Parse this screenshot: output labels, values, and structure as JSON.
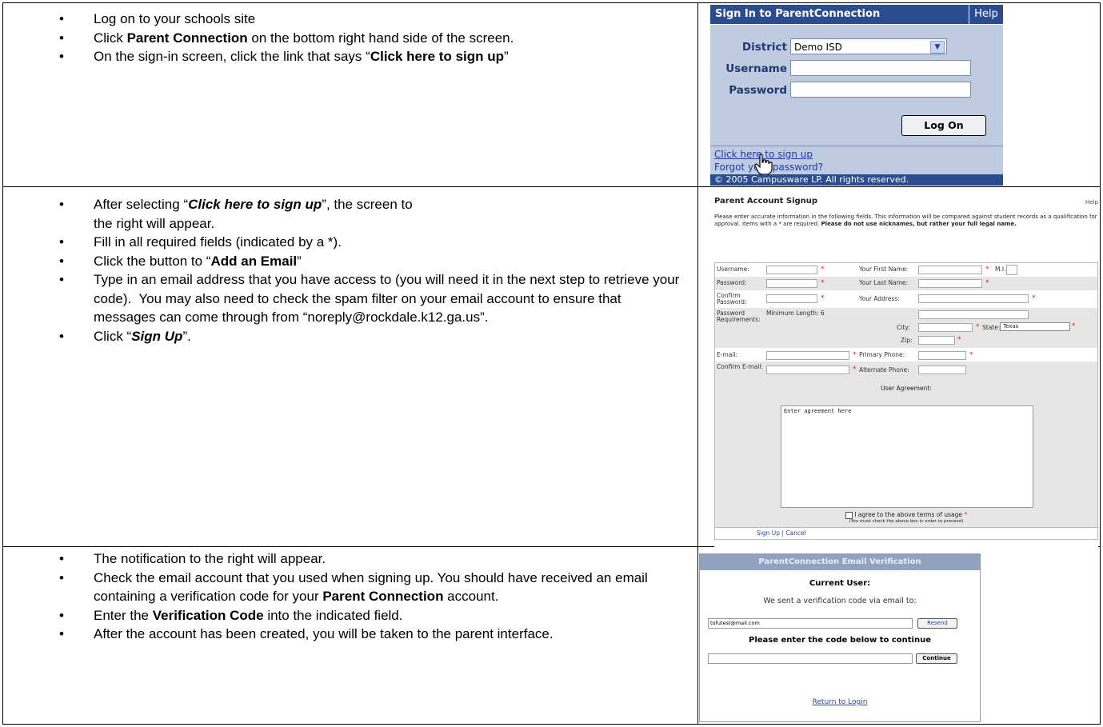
{
  "section1": {
    "steps": [
      [
        "Log on to your schools site"
      ],
      [
        "Click ",
        {
          "b": "Parent Connection"
        },
        " on the bottom right hand side of the screen."
      ],
      [
        "On the sign-in screen, click the link that says “",
        {
          "b": "Click here to sign up"
        },
        "”"
      ]
    ]
  },
  "section2": {
    "steps": [
      [
        "After selecting “",
        {
          "bi": "Click here to sign up"
        },
        "”, the screen to\nthe right will appear."
      ],
      [
        "Fill in all required fields (indicated by a *)."
      ],
      [
        "Click the button to “",
        {
          "b": "Add an Email"
        },
        "”"
      ],
      [
        "Type in an email address that you have access to (you will need it in the next step to retrieve your code).  You may also need to check the spam filter on your email account to ensure that messages can come through from “noreply@rockdale.k12.ga.us”."
      ],
      [
        "Click “",
        {
          "bi": "Sign Up"
        },
        "”."
      ]
    ]
  },
  "section3": {
    "steps": [
      [
        "The notification to the right will appear."
      ],
      [
        "Check the email account that you used when signing up. You should have received an email containing a verification code for your ",
        {
          "b": "Parent Connection"
        },
        " account."
      ],
      [
        "Enter the ",
        {
          "b": "Verification Code"
        },
        " into the indicated field."
      ],
      [
        "After the account has been created, you will be taken to the parent interface."
      ]
    ]
  },
  "signin": {
    "title": "Sign In to ParentConnection",
    "help": "Help",
    "district_label": "District",
    "district_value": "Demo ISD",
    "username_label": "Username",
    "password_label": "Password",
    "logon": "Log On",
    "signup_link": "Click here to sign up",
    "forgot_link": "Forgot your password?",
    "footer": "© 2005 Campusware LP. All rights reserved."
  },
  "signup": {
    "title": "Parent Account Signup",
    "help": "Help",
    "intro": "Please enter accurate information in the following fields.  This information will be compared against student records as a qualification for approval.  Items with a * are required.",
    "intro_bold": "Please do not use nicknames, but rather your full legal name.",
    "username": "Username:",
    "password": "Password:",
    "confirm_password": "Confirm Password:",
    "password_req": "Password Requirements:",
    "min_length": "Minimum Length: 6",
    "email": "E-mail:",
    "confirm_email": "Confirm E-mail:",
    "first_name": "Your First Name:",
    "mi": "M.I.",
    "last_name": "Your Last Name:",
    "address": "Your Address:",
    "city": "City:",
    "state": "State:",
    "state_value": "Texas",
    "zip": "Zip:",
    "primary_phone": "Primary Phone:",
    "alternate_phone": "Alternate Phone:",
    "user_agreement": "User Agreement:",
    "agreement_text": "Enter agreement here",
    "agree": "I agree to the above terms of usage",
    "agree_note": "(You must check the above box in order to proceed)",
    "sign_up": "Sign Up",
    "separator": "|",
    "cancel": "Cancel",
    "asterisk": "*"
  },
  "verify": {
    "title": "ParentConnection Email Verification",
    "current_user": "Current User:",
    "sent": "We sent a verification code via email to:",
    "email_value": "tofutest@mail.com",
    "resend": "Resend",
    "enter_code": "Please enter the code below to continue",
    "continue": "Continue",
    "return": "Return to Login"
  },
  "colors": {
    "signin_header": "#2c4c90",
    "signin_body": "#bfcbe0",
    "link": "#1b3da5",
    "verify_header": "#90a2bf"
  }
}
